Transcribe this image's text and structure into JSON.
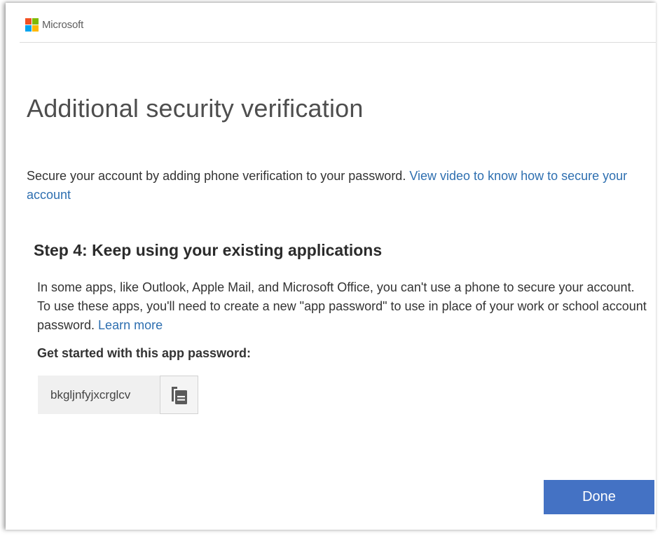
{
  "header": {
    "brand": "Microsoft",
    "logo_colors": [
      "#f25022",
      "#7fba00",
      "#00a4ef",
      "#ffb900"
    ]
  },
  "page": {
    "title": "Additional security verification",
    "intro_text": "Secure your account by adding phone verification to your password. ",
    "intro_link": "View video to know how to secure your account"
  },
  "step": {
    "title": "Step 4: Keep using your existing applications",
    "body_text": "In some apps, like Outlook, Apple Mail, and Microsoft Office, you can't use a phone to secure your account. To use these apps, you'll need to create a new \"app password\" to use in place of your work or school account password. ",
    "learn_more": "Learn more",
    "started_label": "Get started with this app password:",
    "app_password": "bkgljnfyjxcrglcv",
    "copy_icon": "copy-icon"
  },
  "actions": {
    "done_label": "Done"
  },
  "colors": {
    "link": "#2e6fb0",
    "primary_button": "#4472c4"
  }
}
